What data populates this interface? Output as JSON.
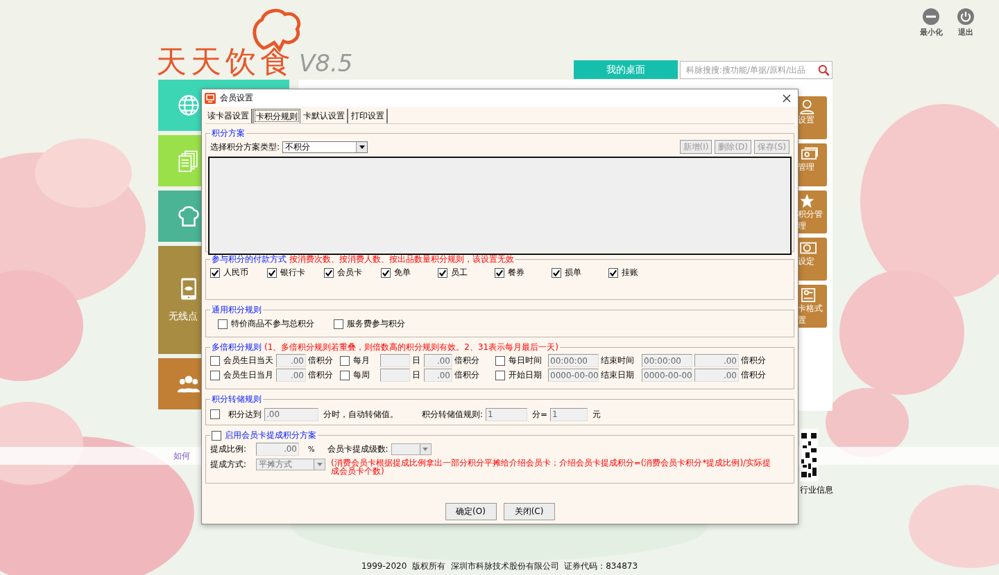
{
  "window_controls": [
    {
      "kind": "minimize",
      "label": "最小化"
    },
    {
      "kind": "power",
      "label": "退出"
    }
  ],
  "app": {
    "logo": {
      "name": "天天饮食",
      "version": "V8.5"
    },
    "desk_tab": "我的桌面",
    "search": {
      "placeholder": "科脉搜搜:搜功能/单据/原料/出品"
    }
  },
  "left_tiles": [
    {
      "kind": "globe",
      "color": "#3dd6b5"
    },
    {
      "kind": "documents",
      "color": "#9ae04a"
    },
    {
      "kind": "chef",
      "color": "#4bb494"
    },
    {
      "kind": "tablet",
      "color": "#a88c42",
      "label": "无线点"
    },
    {
      "kind": "people",
      "color": "#c07f35"
    }
  ],
  "right_tiles": [
    {
      "kind": "person",
      "lines": [
        "设置"
      ]
    },
    {
      "kind": "money",
      "lines": [
        "管理"
      ]
    },
    {
      "kind": "star",
      "lines": [
        "积分管",
        "理"
      ]
    },
    {
      "kind": "coin",
      "lines": [
        "设定"
      ]
    },
    {
      "kind": "card",
      "lines": [
        "卡格式",
        "置"
      ]
    }
  ],
  "help_link": "如何",
  "qr_caption": "行业信息",
  "footer": "1999-2020  版权所有  深圳市科脉技术股份有限公司  证券代码：834873",
  "dialog": {
    "title": "会员设置",
    "tabs": [
      {
        "label": "读卡器设置",
        "selected": false
      },
      {
        "label": "卡积分规则",
        "selected": true
      },
      {
        "label": "卡默认设置",
        "selected": false
      },
      {
        "label": "打印设置",
        "selected": false
      }
    ],
    "scheme": {
      "legend": "积分方案",
      "type_label": "选择积分方案类型:",
      "type_select": {
        "value": "不积分",
        "disabled": false
      },
      "buttons": [
        {
          "label": "新增(I)",
          "disabled": true
        },
        {
          "label": "删除(D)",
          "disabled": true
        },
        {
          "label": "保存(S)",
          "disabled": true
        }
      ]
    },
    "payment": {
      "legend": "参与积分的付款方式",
      "note": "按消费次数、按消费人数、按出品数量积分规则，该设置无效",
      "methods": [
        {
          "label": "人民币",
          "checked": true
        },
        {
          "label": "银行卡",
          "checked": true
        },
        {
          "label": "会员卡",
          "checked": true
        },
        {
          "label": "免单",
          "checked": true
        },
        {
          "label": "员工",
          "checked": true
        },
        {
          "label": "餐券",
          "checked": true
        },
        {
          "label": "损单",
          "checked": true
        },
        {
          "label": "挂账",
          "checked": true
        }
      ]
    },
    "general": {
      "legend": "通用积分规则",
      "options": [
        {
          "label": "特价商品不参与总积分",
          "checked": false
        },
        {
          "label": "服务费参与积分",
          "checked": false
        }
      ]
    },
    "multiple": {
      "legend": "多倍积分规则",
      "note": "(1、多倍积分规则若重叠，则倍数高的积分规则有效。2、31表示每月最后一天)",
      "rows": [
        [
          {
            "kind": "check",
            "label": "会员生日当天",
            "checked": false
          },
          {
            "kind": "input",
            "value": ".00"
          },
          {
            "kind": "text",
            "text": "倍积分"
          },
          {
            "kind": "check",
            "label": "每月",
            "checked": false
          },
          {
            "kind": "input"
          },
          {
            "kind": "text",
            "text": "日"
          },
          {
            "kind": "input",
            "value": ".00"
          },
          {
            "kind": "text",
            "text": "倍积分"
          },
          {
            "kind": "check",
            "label": "每日时间",
            "checked": false
          },
          {
            "kind": "entry",
            "value": "00:00:00"
          },
          {
            "kind": "text",
            "text": "结束时间"
          },
          {
            "kind": "entry",
            "value": "00:00:00"
          },
          {
            "kind": "input",
            "value": ".00"
          },
          {
            "kind": "text",
            "text": "倍积分"
          }
        ],
        [
          {
            "kind": "check",
            "label": "会员生日当月",
            "checked": false
          },
          {
            "kind": "input",
            "value": ".00"
          },
          {
            "kind": "text",
            "text": "倍积分"
          },
          {
            "kind": "check",
            "label": "每周",
            "checked": false
          },
          {
            "kind": "input"
          },
          {
            "kind": "text",
            "text": "日"
          },
          {
            "kind": "input",
            "value": ".00"
          },
          {
            "kind": "text",
            "text": "倍积分"
          },
          {
            "kind": "check",
            "label": "开始日期",
            "checked": false
          },
          {
            "kind": "entry",
            "value": "0000-00-00"
          },
          {
            "kind": "text",
            "text": "结束日期"
          },
          {
            "kind": "entry",
            "value": "0000-00-00"
          },
          {
            "kind": "input",
            "value": ".00"
          },
          {
            "kind": "text",
            "text": "倍积分"
          }
        ]
      ]
    },
    "transfer": {
      "legend": "积分转储规则",
      "enabled": false,
      "reach_label": "积分达到",
      "reach_value": ".00",
      "reach_suffix": "分时，自动转储值。",
      "rule_label": "积分转储值规则:",
      "points_value": "1",
      "points_suffix": "分=",
      "yuan_value": "1",
      "yuan_suffix": "元"
    },
    "commission": {
      "legend": "启用会员卡提成积分方案",
      "enabled": false,
      "ratio_label": "提成比例:",
      "ratio_value": ".00",
      "ratio_unit": "%",
      "levels_label": "会员卡提成级数:",
      "levels_select": {
        "disabled": true
      },
      "method_label": "提成方式:",
      "method_select": {
        "value": "平摊方式",
        "disabled": true
      },
      "note": "(消费会员卡根据提成比例拿出一部分积分平摊给介绍会员卡；介绍会员卡提成积分=(消费会员卡积分*提成比例)/实际提成会员卡个数)"
    },
    "buttons": [
      {
        "label": "确定(O)",
        "disabled": false
      },
      {
        "label": "关闭(C)",
        "disabled": false
      }
    ]
  }
}
